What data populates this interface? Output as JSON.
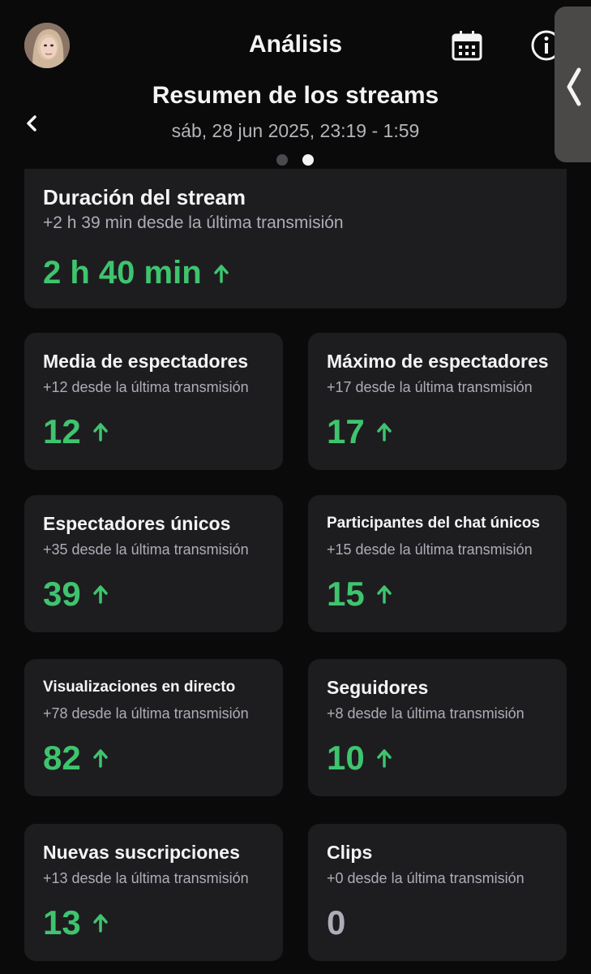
{
  "header": {
    "title": "Análisis",
    "calendar_icon": "calendar-icon",
    "info_icon": "info-icon",
    "side_tab_icon": "chevron-left-icon"
  },
  "summary": {
    "title": "Resumen de los streams",
    "date": "sáb, 28 jun 2025, 23:19 - 1:59",
    "back_icon": "chevron-left-icon"
  },
  "pagination": {
    "current": 2,
    "total": 2
  },
  "colors": {
    "positive": "#3fc46e",
    "card_bg": "#1d1d20",
    "neutral": "#adadb8"
  },
  "stats": {
    "duration": {
      "title": "Duración del stream",
      "sub": "+2 h 39 min desde la última transmisión",
      "value": "2 h 40 min",
      "trend": "up"
    },
    "avg_viewers": {
      "title": "Media de espectadores",
      "sub": "+12 desde la última transmisión",
      "value": "12",
      "trend": "up"
    },
    "max_viewers": {
      "title": "Máximo de espectadores",
      "sub": "+17 desde la última transmisión",
      "value": "17",
      "trend": "up"
    },
    "unique_viewers": {
      "title": "Espectadores únicos",
      "sub": "+35 desde la última transmisión",
      "value": "39",
      "trend": "up"
    },
    "chat_participants": {
      "title": "Participantes del chat únicos",
      "sub": "+15 desde la última transmisión",
      "value": "15",
      "trend": "up"
    },
    "live_views": {
      "title": "Visualizaciones en directo",
      "sub": "+78 desde la última transmisión",
      "value": "82",
      "trend": "up"
    },
    "followers": {
      "title": "Seguidores",
      "sub": "+8 desde la última transmisión",
      "value": "10",
      "trend": "up"
    },
    "new_subs": {
      "title": "Nuevas suscripciones",
      "sub": "+13 desde la última transmisión",
      "value": "13",
      "trend": "up"
    },
    "clips": {
      "title": "Clips",
      "sub": "+0 desde la última transmisión",
      "value": "0",
      "trend": "none"
    }
  }
}
